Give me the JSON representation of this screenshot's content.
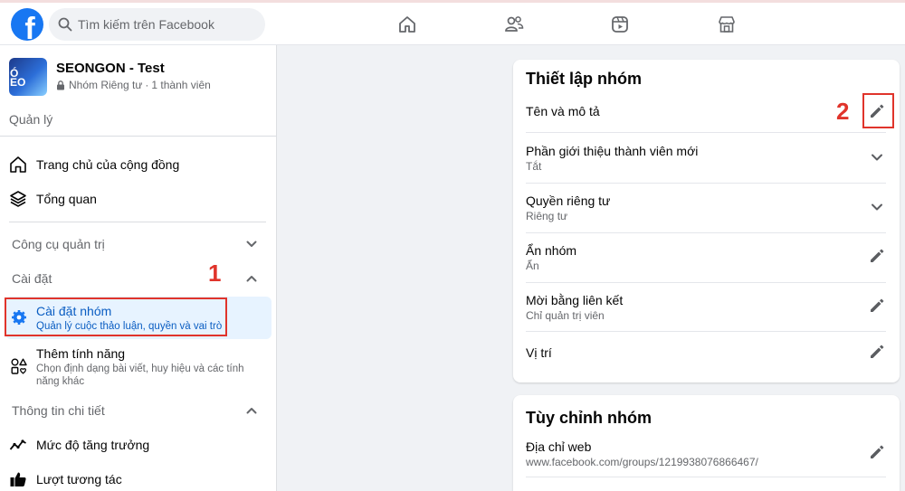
{
  "topbar": {
    "logo_letter": "f",
    "search_placeholder": "Tìm kiếm trên Facebook"
  },
  "group": {
    "thumb_text": "Ó EO",
    "name": "SEONGON - Test",
    "privacy": "Nhóm Riêng tư",
    "separator": "·",
    "members": "1 thành viên"
  },
  "sidebar": {
    "manage_label": "Quản lý",
    "home": "Trang chủ của cộng đồng",
    "overview": "Tổng quan",
    "admin_tools": "Công cụ quản trị",
    "settings": "Cài đặt",
    "group_settings": {
      "label": "Cài đặt nhóm",
      "sub": "Quản lý cuộc thảo luận, quyền và vai trò"
    },
    "add_features": {
      "label": "Thêm tính năng",
      "sub": "Chọn định dạng bài viết, huy hiệu và các tính năng khác"
    },
    "insights": "Thông tin chi tiết",
    "growth": "Mức độ tăng trưởng",
    "engagement": "Lượt tương tác"
  },
  "annotations": {
    "step1": "1",
    "step2": "2",
    "color": "#e0342b"
  },
  "settings_card": {
    "title": "Thiết lập nhóm",
    "rows": [
      {
        "label": "Tên và mô tả",
        "sub": ""
      },
      {
        "label": "Phần giới thiệu thành viên mới",
        "sub": "Tắt"
      },
      {
        "label": "Quyền riêng tư",
        "sub": "Riêng tư"
      },
      {
        "label": "Ẩn nhóm",
        "sub": "Ẩn"
      },
      {
        "label": "Mời bằng liên kết",
        "sub": "Chỉ quản trị viên"
      },
      {
        "label": "Vị trí",
        "sub": ""
      }
    ]
  },
  "customize_card": {
    "title": "Tùy chỉnh nhóm",
    "web_label": "Địa chỉ web",
    "web_url": "www.facebook.com/groups/1219938076866467/"
  },
  "colors": {
    "accent": "#1877f2",
    "active_bg": "#e7f3ff",
    "active_text": "#0a5dc2"
  }
}
